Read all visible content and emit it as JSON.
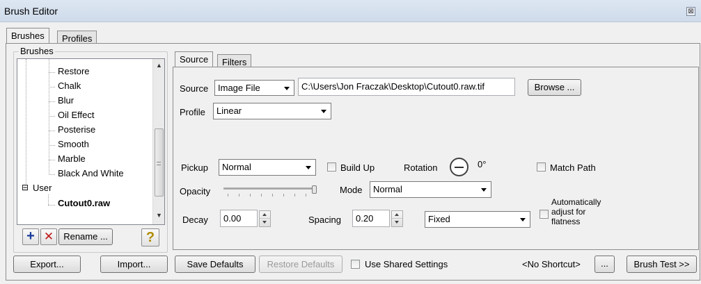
{
  "window": {
    "title": "Brush Editor",
    "close_glyph": "⊠"
  },
  "outer_tabs": [
    {
      "label": "Brushes"
    },
    {
      "label": "Profiles"
    }
  ],
  "brushes_group": {
    "label": "Brushes",
    "tree": [
      {
        "label": "Restore",
        "bold": false
      },
      {
        "label": "Chalk",
        "bold": false
      },
      {
        "label": "Blur",
        "bold": false
      },
      {
        "label": "Oil Effect",
        "bold": false
      },
      {
        "label": "Posterise",
        "bold": false
      },
      {
        "label": "Smooth",
        "bold": false
      },
      {
        "label": "Marble",
        "bold": false
      },
      {
        "label": "Black And White",
        "bold": false
      },
      {
        "label": "User",
        "bold": false,
        "expander": "⊟"
      },
      {
        "label": "Cutout0.raw",
        "bold": true
      }
    ],
    "scroll_position": 0.72
  },
  "tree_buttons": {
    "add_glyph": "+",
    "delete_glyph": "✕",
    "rename_label": "Rename ...",
    "help_glyph": "?"
  },
  "bottom_left": {
    "export_label": "Export...",
    "import_label": "Import..."
  },
  "inner_tabs": [
    {
      "label": "Source"
    },
    {
      "label": "Filters"
    }
  ],
  "source": {
    "source_label": "Source",
    "source_value": "Image File",
    "path_value": "C:\\Users\\Jon Fraczak\\Desktop\\Cutout0.raw.tif",
    "browse_label": "Browse ...",
    "profile_label": "Profile",
    "profile_value": "Linear"
  },
  "settings": {
    "pickup_label": "Pickup",
    "pickup_value": "Normal",
    "buildup_label": "Build Up",
    "buildup_checked": false,
    "rotation_label": "Rotation",
    "rotation_value": "0°",
    "matchpath_label": "Match Path",
    "matchpath_checked": false,
    "opacity_label": "Opacity",
    "opacity_level": 1.0,
    "mode_label": "Mode",
    "mode_value": "Normal",
    "decay_label": "Decay",
    "decay_value": "0.00",
    "spacing_label": "Spacing",
    "spacing_value": "0.20",
    "spacing_mode_value": "Fixed",
    "auto_adjust_label_1": "Automatically",
    "auto_adjust_label_2": "adjust for",
    "auto_adjust_label_3": "flatness",
    "auto_adjust_checked": false
  },
  "bottom_bar": {
    "save_defaults_label": "Save Defaults",
    "restore_defaults_label": "Restore Defaults",
    "use_shared_label": "Use Shared Settings",
    "shortcut_label": "<No Shortcut>",
    "ellipsis_label": "...",
    "brush_test_label": "Brush Test >>"
  }
}
